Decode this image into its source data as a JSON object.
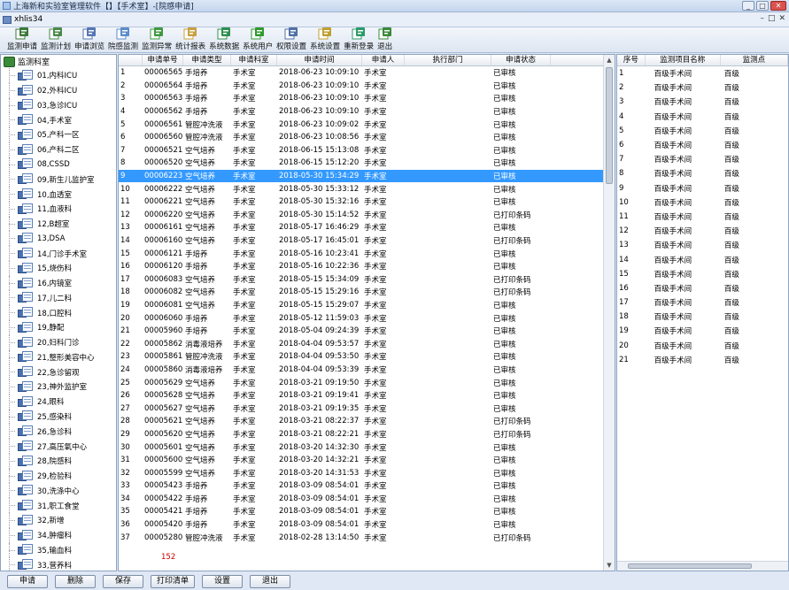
{
  "window": {
    "title": "上海新和实验室管理软件【】【手术室】-[院感申请]"
  },
  "menubar": {
    "doc_title": "xhlis34"
  },
  "toolbar": [
    {
      "label": "监测申请",
      "icon": "apply-icon"
    },
    {
      "label": "监测计划",
      "icon": "plan-icon"
    },
    {
      "label": "申请浏览",
      "icon": "browse-icon"
    },
    {
      "label": "院感监测",
      "icon": "monitor-icon"
    },
    {
      "label": "监测异常",
      "icon": "abnormal-icon"
    },
    {
      "label": "统计报表",
      "icon": "report-icon"
    },
    {
      "label": "系统数据",
      "icon": "data-icon"
    },
    {
      "label": "系统用户",
      "icon": "user-icon"
    },
    {
      "label": "权限设置",
      "icon": "permission-icon"
    },
    {
      "label": "系统设置",
      "icon": "settings-icon"
    },
    {
      "label": "重新登录",
      "icon": "relogin-icon"
    },
    {
      "label": "退出",
      "icon": "exit-icon"
    }
  ],
  "tree": {
    "root": "监测科室",
    "items": [
      "01,内科ICU",
      "02,外科ICU",
      "03,急诊ICU",
      "04,手术室",
      "05,产科一区",
      "06,产科二区",
      "08,CSSD",
      "09,新生儿监护室",
      "10,血透室",
      "11,血液科",
      "12,B超室",
      "13,DSA",
      "14,门诊手术室",
      "15,烧伤科",
      "16,内镜室",
      "17,儿二科",
      "18,口腔科",
      "19,静配",
      "20,妇科门诊",
      "21,整形美容中心",
      "22,急诊留观",
      "23,神外监护室",
      "24,眼科",
      "25,感染科",
      "26,急诊科",
      "27,高压氧中心",
      "28,院感科",
      "29,检验科",
      "30,洗涤中心",
      "31,职工食堂",
      "32,新增",
      "34,肿瘤科",
      "35,输血科",
      "33,营养科"
    ]
  },
  "grid": {
    "headers": [
      "",
      "申请单号",
      "申请类型",
      "申请科室",
      "申请时间",
      "申请人",
      "执行部门",
      "申请状态",
      ""
    ],
    "selected_index": 8,
    "rows": [
      [
        "1",
        "00006565",
        "手培养",
        "手术室",
        "2018-06-23 10:09:10",
        "手术室",
        "",
        "已审核"
      ],
      [
        "2",
        "00006564",
        "手培养",
        "手术室",
        "2018-06-23 10:09:10",
        "手术室",
        "",
        "已审核"
      ],
      [
        "3",
        "00006563",
        "手培养",
        "手术室",
        "2018-06-23 10:09:10",
        "手术室",
        "",
        "已审核"
      ],
      [
        "4",
        "00006562",
        "手培养",
        "手术室",
        "2018-06-23 10:09:10",
        "手术室",
        "",
        "已审核"
      ],
      [
        "5",
        "00006561",
        "管腔冲洗液",
        "手术室",
        "2018-06-23 10:09:02",
        "手术室",
        "",
        "已审核"
      ],
      [
        "6",
        "00006560",
        "管腔冲洗液",
        "手术室",
        "2018-06-23 10:08:56",
        "手术室",
        "",
        "已审核"
      ],
      [
        "7",
        "00006521",
        "空气培养",
        "手术室",
        "2018-06-15 15:13:08",
        "手术室",
        "",
        "已审核"
      ],
      [
        "8",
        "00006520",
        "空气培养",
        "手术室",
        "2018-06-15 15:12:20",
        "手术室",
        "",
        "已审核"
      ],
      [
        "9",
        "00006223",
        "空气培养",
        "手术室",
        "2018-05-30 15:34:29",
        "手术室",
        "",
        "已审核"
      ],
      [
        "10",
        "00006222",
        "空气培养",
        "手术室",
        "2018-05-30 15:33:12",
        "手术室",
        "",
        "已审核"
      ],
      [
        "11",
        "00006221",
        "空气培养",
        "手术室",
        "2018-05-30 15:32:16",
        "手术室",
        "",
        "已审核"
      ],
      [
        "12",
        "00006220",
        "空气培养",
        "手术室",
        "2018-05-30 15:14:52",
        "手术室",
        "",
        "已打印条码"
      ],
      [
        "13",
        "00006161",
        "空气培养",
        "手术室",
        "2018-05-17 16:46:29",
        "手术室",
        "",
        "已审核"
      ],
      [
        "14",
        "00006160",
        "空气培养",
        "手术室",
        "2018-05-17 16:45:01",
        "手术室",
        "",
        "已打印条码"
      ],
      [
        "15",
        "00006121",
        "手培养",
        "手术室",
        "2018-05-16 10:23:41",
        "手术室",
        "",
        "已审核"
      ],
      [
        "16",
        "00006120",
        "手培养",
        "手术室",
        "2018-05-16 10:22:36",
        "手术室",
        "",
        "已审核"
      ],
      [
        "17",
        "00006083",
        "空气培养",
        "手术室",
        "2018-05-15 15:34:09",
        "手术室",
        "",
        "已打印条码"
      ],
      [
        "18",
        "00006082",
        "空气培养",
        "手术室",
        "2018-05-15 15:29:16",
        "手术室",
        "",
        "已打印条码"
      ],
      [
        "19",
        "00006081",
        "空气培养",
        "手术室",
        "2018-05-15 15:29:07",
        "手术室",
        "",
        "已审核"
      ],
      [
        "20",
        "00006060",
        "手培养",
        "手术室",
        "2018-05-12 11:59:03",
        "手术室",
        "",
        "已审核"
      ],
      [
        "21",
        "00005960",
        "手培养",
        "手术室",
        "2018-05-04 09:24:39",
        "手术室",
        "",
        "已审核"
      ],
      [
        "22",
        "00005862",
        "消毒液培养",
        "手术室",
        "2018-04-04 09:53:57",
        "手术室",
        "",
        "已审核"
      ],
      [
        "23",
        "00005861",
        "管腔冲洗液",
        "手术室",
        "2018-04-04 09:53:50",
        "手术室",
        "",
        "已审核"
      ],
      [
        "24",
        "00005860",
        "消毒液培养",
        "手术室",
        "2018-04-04 09:53:39",
        "手术室",
        "",
        "已审核"
      ],
      [
        "25",
        "00005629",
        "空气培养",
        "手术室",
        "2018-03-21 09:19:50",
        "手术室",
        "",
        "已审核"
      ],
      [
        "26",
        "00005628",
        "空气培养",
        "手术室",
        "2018-03-21 09:19:41",
        "手术室",
        "",
        "已审核"
      ],
      [
        "27",
        "00005627",
        "空气培养",
        "手术室",
        "2018-03-21 09:19:35",
        "手术室",
        "",
        "已审核"
      ],
      [
        "28",
        "00005621",
        "空气培养",
        "手术室",
        "2018-03-21 08:22:37",
        "手术室",
        "",
        "已打印条码"
      ],
      [
        "29",
        "00005620",
        "空气培养",
        "手术室",
        "2018-03-21 08:22:21",
        "手术室",
        "",
        "已打印条码"
      ],
      [
        "30",
        "00005601",
        "空气培养",
        "手术室",
        "2018-03-20 14:32:30",
        "手术室",
        "",
        "已审核"
      ],
      [
        "31",
        "00005600",
        "空气培养",
        "手术室",
        "2018-03-20 14:32:21",
        "手术室",
        "",
        "已审核"
      ],
      [
        "32",
        "00005599",
        "空气培养",
        "手术室",
        "2018-03-20 14:31:53",
        "手术室",
        "",
        "已审核"
      ],
      [
        "33",
        "00005423",
        "手培养",
        "手术室",
        "2018-03-09 08:54:01",
        "手术室",
        "",
        "已审核"
      ],
      [
        "34",
        "00005422",
        "手培养",
        "手术室",
        "2018-03-09 08:54:01",
        "手术室",
        "",
        "已审核"
      ],
      [
        "35",
        "00005421",
        "手培养",
        "手术室",
        "2018-03-09 08:54:01",
        "手术室",
        "",
        "已审核"
      ],
      [
        "36",
        "00005420",
        "手培养",
        "手术室",
        "2018-03-09 08:54:01",
        "手术室",
        "",
        "已审核"
      ],
      [
        "37",
        "00005280",
        "管腔冲洗液",
        "手术室",
        "2018-02-28 13:14:50",
        "手术室",
        "",
        "已打印条码"
      ]
    ],
    "footer_count": "152"
  },
  "detail": {
    "headers": [
      "序号",
      "监测项目名称",
      "监测点"
    ],
    "rows": [
      [
        "1",
        "百级手术间",
        "百级"
      ],
      [
        "2",
        "百级手术间",
        "百级"
      ],
      [
        "3",
        "百级手术间",
        "百级"
      ],
      [
        "4",
        "百级手术间",
        "百级"
      ],
      [
        "5",
        "百级手术间",
        "百级"
      ],
      [
        "6",
        "百级手术间",
        "百级"
      ],
      [
        "7",
        "百级手术间",
        "百级"
      ],
      [
        "8",
        "百级手术间",
        "百级"
      ],
      [
        "9",
        "百级手术间",
        "百级"
      ],
      [
        "10",
        "百级手术间",
        "百级"
      ],
      [
        "11",
        "百级手术间",
        "百级"
      ],
      [
        "12",
        "百级手术间",
        "百级"
      ],
      [
        "13",
        "百级手术间",
        "百级"
      ],
      [
        "14",
        "百级手术间",
        "百级"
      ],
      [
        "15",
        "百级手术间",
        "百级"
      ],
      [
        "16",
        "百级手术间",
        "百级"
      ],
      [
        "17",
        "百级手术间",
        "百级"
      ],
      [
        "18",
        "百级手术间",
        "百级"
      ],
      [
        "19",
        "百级手术间",
        "百级"
      ],
      [
        "20",
        "百级手术间",
        "百级"
      ],
      [
        "21",
        "百级手术间",
        "百级"
      ]
    ]
  },
  "buttons": [
    {
      "label": "申请",
      "name": "apply-button",
      "width": 46
    },
    {
      "label": "删除",
      "name": "delete-button",
      "width": 46
    },
    {
      "label": "保存",
      "name": "save-button",
      "width": 46
    },
    {
      "label": "打印清单",
      "name": "print-list-button",
      "width": 50
    },
    {
      "label": "设置",
      "name": "settings-button",
      "width": 46
    },
    {
      "label": "退出",
      "name": "exit-button",
      "width": 46
    }
  ],
  "colors": {
    "selection": "#3399ff",
    "count": "#cc0000"
  }
}
